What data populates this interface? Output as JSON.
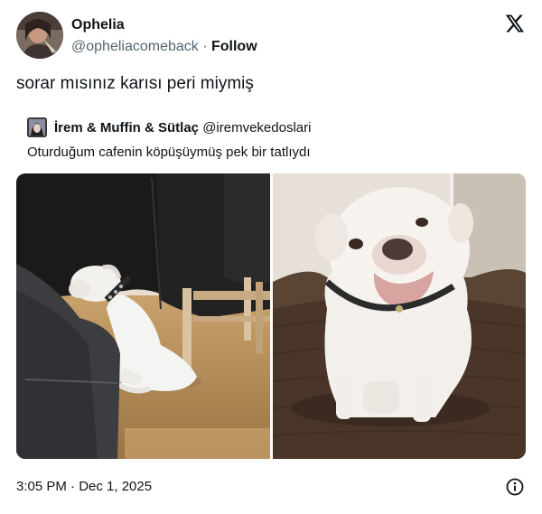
{
  "author": {
    "display_name": "Ophelia",
    "handle": "@opheliacomeback",
    "separator": " · ",
    "follow_label": "Follow",
    "avatar_icon": "user-avatar"
  },
  "brand_icon": "x-logo-icon",
  "tweet": {
    "text": "sorar mısınız karısı peri miymiş"
  },
  "quoted": {
    "display_name": "İrem & Muffin & Sütlaç",
    "handle": "@iremvekedoslari",
    "text": "Oturduğum cafenin köpüşüymüş pek bir tatlıydı"
  },
  "media": {
    "count": 2,
    "items": [
      "photo-dog-cafe",
      "photo-dog-bed"
    ]
  },
  "footer": {
    "timestamp": "3:05 PM · Dec 1, 2025",
    "info_icon": "info-icon"
  },
  "colors": {
    "text_primary": "#0f1419",
    "text_secondary": "#536471",
    "background": "#ffffff"
  }
}
